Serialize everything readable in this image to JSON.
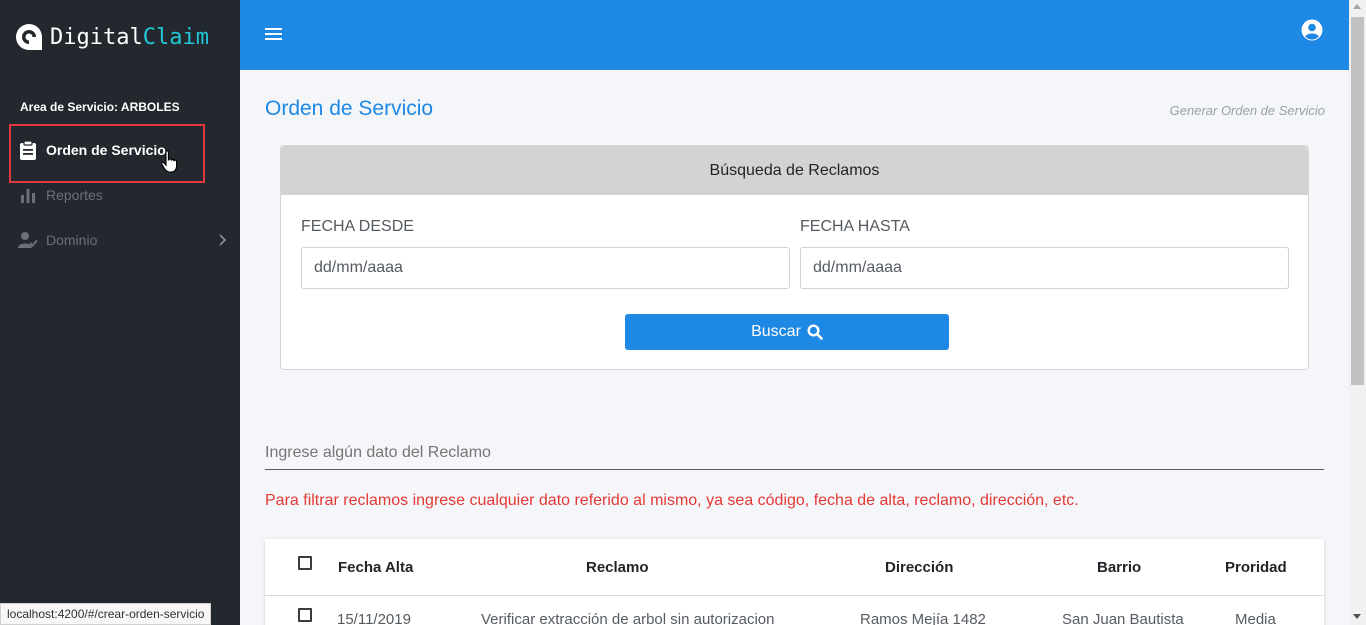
{
  "brand": {
    "logo_white": "Digital",
    "logo_cyan": "Claim"
  },
  "sidebar": {
    "area_label": "Area de Servicio: ARBOLES",
    "items": [
      {
        "label": "Orden de Servicio",
        "icon": "clipboard-icon"
      },
      {
        "label": "Reportes",
        "icon": "bar-chart-icon"
      },
      {
        "label": "Dominio",
        "icon": "user-check-icon"
      }
    ]
  },
  "main": {
    "title": "Orden de Servicio",
    "breadcrumb": "Generar Orden de Servicio",
    "search_card": {
      "header": "Búsqueda de Reclamos",
      "from_label": "FECHA DESDE",
      "from_value": "dd/mm/aaaa",
      "to_label": "FECHA HASTA",
      "to_value": "dd/mm/aaaa",
      "button": "Buscar"
    },
    "filter_placeholder": "Ingrese algún dato del Reclamo",
    "filter_hint": "Para filtrar reclamos ingrese cualquier dato referido al mismo, ya sea código, fecha de alta, reclamo, dirección, etc.",
    "table": {
      "columns": [
        "Fecha Alta",
        "Reclamo",
        "Dirección",
        "Barrio",
        "Proridad"
      ],
      "rows": [
        [
          "15/11/2019",
          "Verificar extracción de arbol sin autorizacion",
          "Ramos Mejía 1482",
          "San Juan Bautista",
          "Media"
        ]
      ]
    }
  },
  "status_bar": {
    "url": "localhost:4200/#/crear-orden-servicio"
  },
  "colors": {
    "primary": "#1e88e5",
    "sidebar": "#23282e",
    "accent_cyan": "#23c8d8",
    "hint_red": "#e53935",
    "highlight": "#e0393e"
  }
}
